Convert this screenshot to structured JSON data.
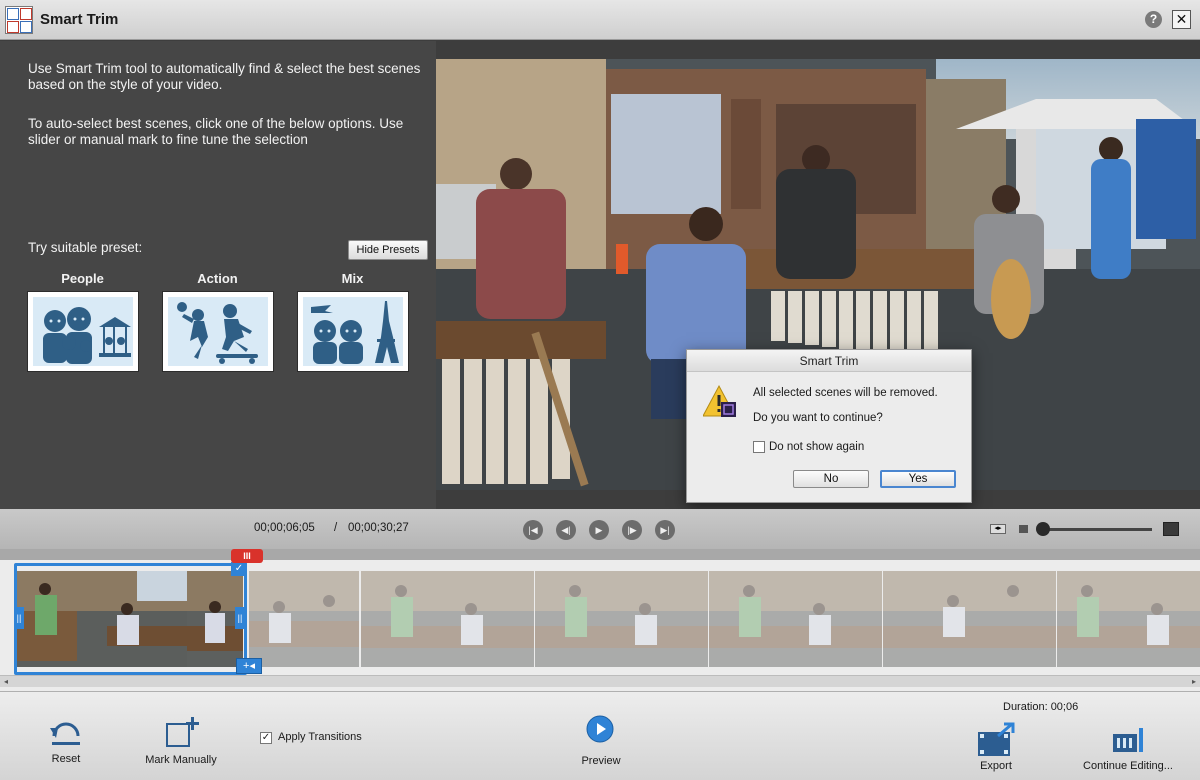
{
  "window": {
    "title": "Smart Trim",
    "help_label": "?",
    "close_label": "✕"
  },
  "instructions": {
    "line1": "Use Smart Trim tool to automatically find & select the best scenes based on the style of your video.",
    "line2": "To auto-select best scenes, click one of the below options. Use slider or manual mark to fine tune the selection"
  },
  "presets": {
    "label": "Try suitable preset:",
    "hide_button": "Hide Presets",
    "items": [
      {
        "name": "People",
        "icon": "people-preset-icon"
      },
      {
        "name": "Action",
        "icon": "action-preset-icon"
      },
      {
        "name": "Mix",
        "icon": "mix-preset-icon"
      }
    ]
  },
  "dialog": {
    "title": "Smart Trim",
    "message1": "All selected scenes will be removed.",
    "message2": "Do you want to continue?",
    "checkbox_label": "Do not show again",
    "checkbox_checked": false,
    "no_label": "No",
    "yes_label": "Yes"
  },
  "transport": {
    "current_time": "00;00;06;05",
    "separator": "/",
    "total_time": "00;00;30;27",
    "buttons": [
      "go-to-start",
      "step-back",
      "play",
      "step-forward",
      "go-to-end"
    ]
  },
  "timeline": {
    "playhead_glyph": "III",
    "thumbnail_count": 7,
    "selected_thumbnails": 1
  },
  "toolbar": {
    "reset_label": "Reset",
    "mark_manually_label": "Mark Manually",
    "apply_transitions_label": "Apply Transitions",
    "apply_transitions_checked": true,
    "preview_label": "Preview",
    "duration_label": "Duration: 00;06",
    "export_label": "Export",
    "continue_label": "Continue Editing..."
  },
  "colors": {
    "accent": "#2f83d6",
    "playhead": "#d9322b",
    "panel": "#464646"
  }
}
